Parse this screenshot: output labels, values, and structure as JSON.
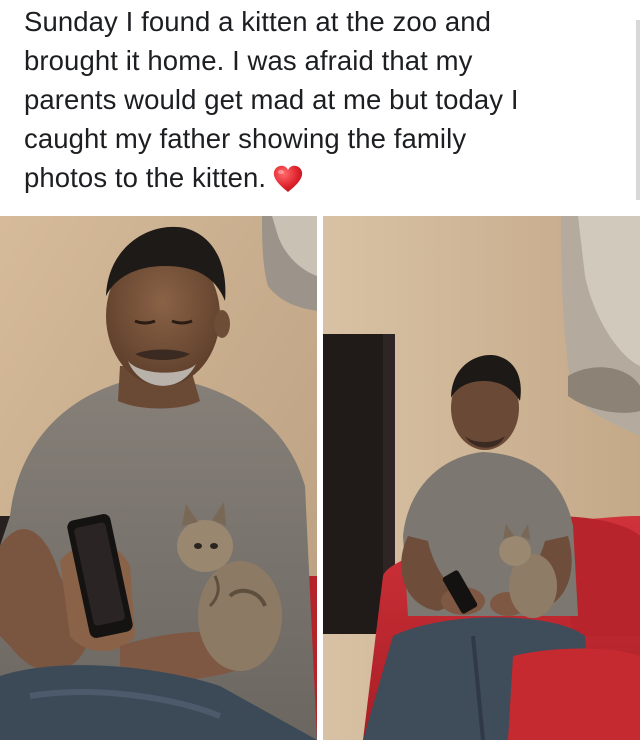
{
  "post": {
    "caption": "Sunday I found a kitten at the zoo and brought it home. I was afraid that my parents would get mad at me but today I caught my father showing the family photos to the kitten.",
    "caption_lines": [
      "Sunday I found a kitten at the zoo and",
      "brought it home. I was afraid that my",
      "parents would get mad at me but today I",
      "caught my father showing the family",
      "photos to the kitten."
    ],
    "emoji": "heart-icon"
  },
  "photos": [
    {
      "name": "photo-left-closeup"
    },
    {
      "name": "photo-right-wide"
    }
  ],
  "colors": {
    "text": "#1c1e21",
    "heart": "#e0242f",
    "wall": "#cdb294",
    "shirt": "#7b7670",
    "sofa": "#c2262b",
    "jeans": "#3c4a58"
  }
}
